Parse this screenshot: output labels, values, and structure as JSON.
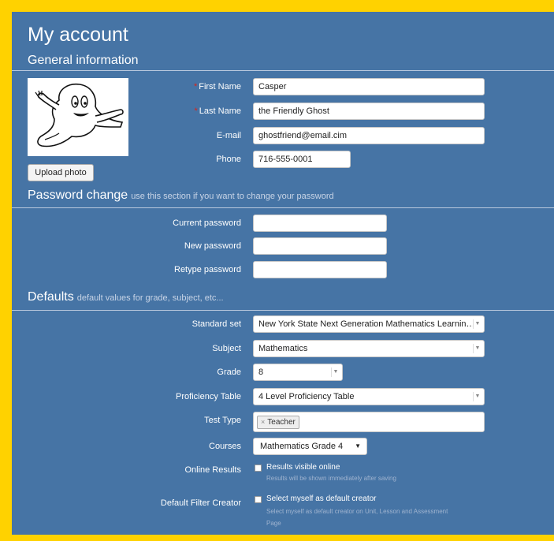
{
  "page": {
    "title": "My account"
  },
  "general": {
    "heading": "General information",
    "upload_label": "Upload photo",
    "photo_alt": "ghost-illustration",
    "fields": {
      "first_name": {
        "label": "First Name",
        "value": "Casper",
        "required": true
      },
      "last_name": {
        "label": "Last Name",
        "value": "the Friendly Ghost",
        "required": true
      },
      "email": {
        "label": "E-mail",
        "value": "ghostfriend@email.cim"
      },
      "phone": {
        "label": "Phone",
        "value": "716-555-0001"
      }
    },
    "required_marker": "*"
  },
  "password": {
    "heading": "Password change",
    "subheading": "use this section if you want to change your password",
    "current_label": "Current password",
    "new_label": "New password",
    "retype_label": "Retype password",
    "current_value": "",
    "new_value": "",
    "retype_value": ""
  },
  "defaults": {
    "heading": "Defaults",
    "subheading": "default values for grade, subject, etc...",
    "standard_set": {
      "label": "Standard set",
      "value": "New York State Next Generation Mathematics Learnin…"
    },
    "subject": {
      "label": "Subject",
      "value": "Mathematics"
    },
    "grade": {
      "label": "Grade",
      "value": "8"
    },
    "proficiency": {
      "label": "Proficiency Table",
      "value": "4 Level Proficiency Table"
    },
    "test_type": {
      "label": "Test Type",
      "tag": "Teacher",
      "tag_remove": "×"
    },
    "courses": {
      "label": "Courses",
      "value": "Mathematics Grade 4"
    },
    "online_results": {
      "label": "Online Results",
      "checkbox_label": "Results visible online",
      "hint": "Results will be shown immediately after saving",
      "checked": false
    },
    "filter_creator": {
      "label": "Default Filter Creator",
      "checkbox_label": "Select myself as default creator",
      "hint_line1": "Select myself as default creator on Unit, Lesson and Assessment",
      "hint_line2": "Page",
      "checked": false
    }
  },
  "colors": {
    "background": "#ffd200",
    "panel": "#4674a5",
    "required": "#d9241b"
  },
  "icons": {
    "dropdown": "chevron-down-icon",
    "caret": "caret-down-icon"
  }
}
